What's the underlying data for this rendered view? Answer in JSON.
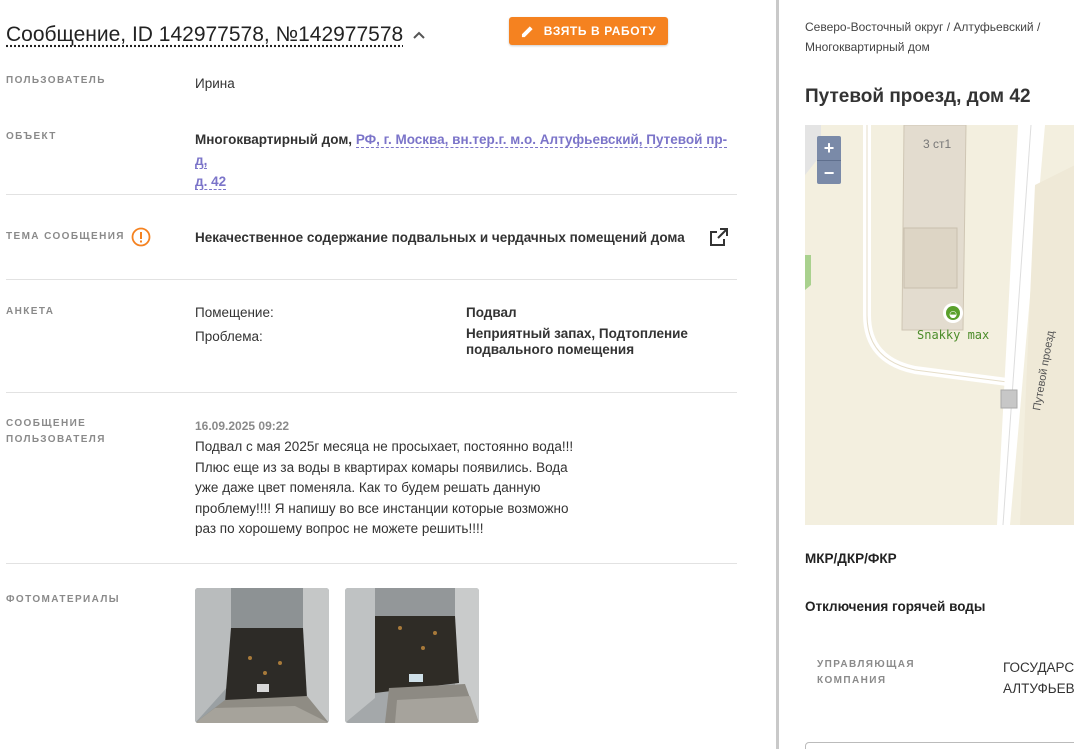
{
  "header": {
    "title": "Сообщение, ID 142977578, №142977578",
    "take_button": "ВЗЯТЬ В РАБОТУ",
    "accent": "#f58220"
  },
  "fields": {
    "user": {
      "label": "ПОЛЬЗОВАТЕЛЬ",
      "value": "Ирина"
    },
    "object": {
      "label": "ОБЪЕКТ",
      "type": "Многоквартирный дом,",
      "address_line1": "РФ, г. Москва, вн.тер.г. м.о. Алтуфьевский, Путевой пр-д,",
      "address_line2": "д. 42"
    },
    "topic": {
      "label": "ТЕМА СООБЩЕНИЯ",
      "value": "Некачественное содержание подвальных и чердачных помещений дома"
    },
    "survey": {
      "label": "АНКЕТА",
      "rows": [
        {
          "key": "Помещение:",
          "value1": "Подвал",
          "value2": ""
        },
        {
          "key": "Проблема:",
          "value1": "Неприятный запах, Подтопление",
          "value2": "подвального помещения"
        }
      ]
    },
    "message": {
      "label_line1": "СООБЩЕНИЕ",
      "label_line2": "ПОЛЬЗОВАТЕЛЯ",
      "date": "16.09.2025 09:22",
      "lines": [
        "Подвал с мая 2025г месяца не просыхает, постоянно вода!!!",
        "Плюс еще из за воды в квартирах комары появились. Вода",
        "уже даже цвет поменяла. Как то будем решать данную",
        "проблему!!!! Я напишу во все инстанции которые возможно",
        "раз по хорошему вопрос не можете решить!!!!"
      ]
    },
    "photos": {
      "label": "ФОТОМАТЕРИАЛЫ",
      "count": 2
    }
  },
  "right": {
    "breadcrumb_line1": "Северо-Восточный округ / Алтуфьевский /",
    "breadcrumb_line2": "Многоквартирный дом",
    "address_title": "Путевой проезд, дом 42",
    "map": {
      "building_label": "3 ст1",
      "poi_label": "Snakky max",
      "street_label": "Путевой проезд",
      "zoom_in": "+",
      "zoom_out": "−"
    },
    "program": "МКР/ДКР/ФКР",
    "hot_water": "Отключения горячей воды",
    "management": {
      "label_line1": "УПРАВЛЯЮЩАЯ",
      "label_line2": "КОМПАНИЯ",
      "value_line1": "ГОСУДАРСТ",
      "value_line2": "АЛТУФЬЕВ"
    }
  }
}
